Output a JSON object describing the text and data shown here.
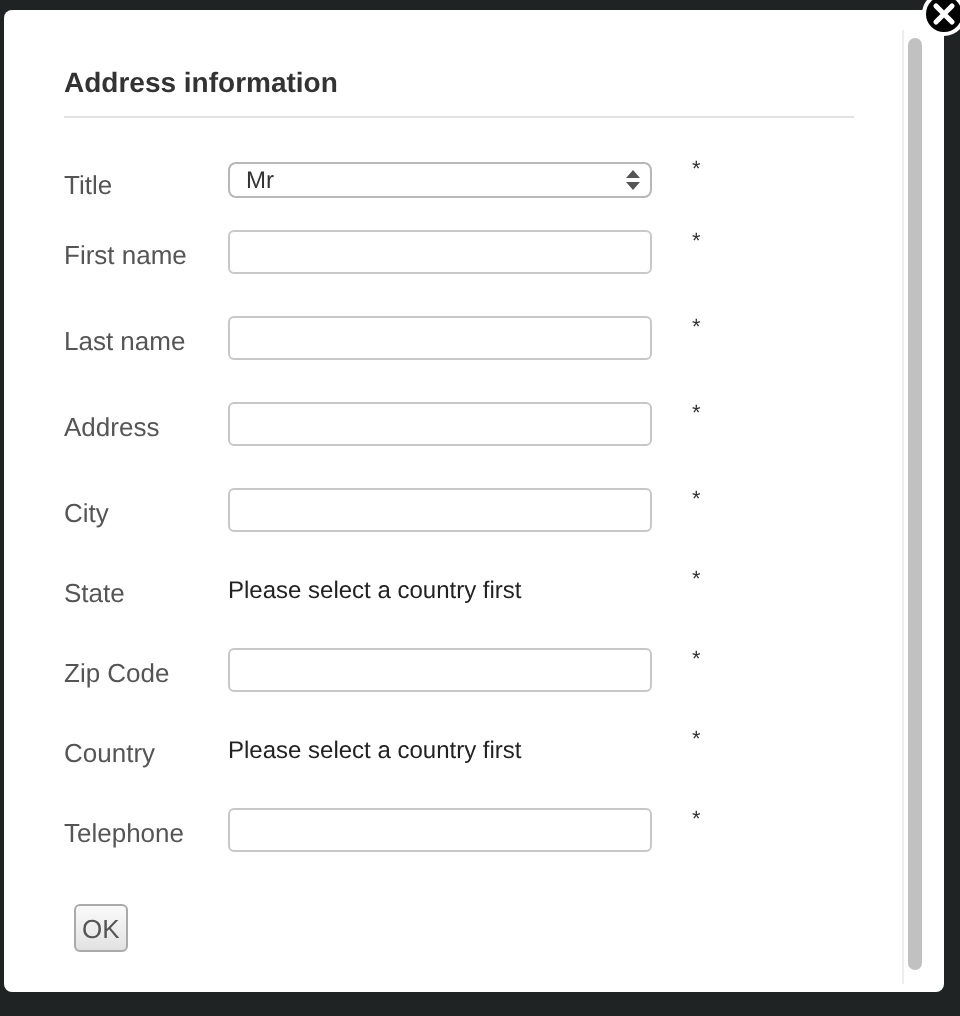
{
  "dialog": {
    "heading": "Address information",
    "fields": [
      {
        "kind": "select",
        "label": "Title",
        "value": "Mr",
        "required_mark": "*"
      },
      {
        "kind": "input",
        "label": "First name",
        "required_mark": "*"
      },
      {
        "kind": "input",
        "label": "Last name",
        "required_mark": "*"
      },
      {
        "kind": "input",
        "label": "Address",
        "required_mark": "*"
      },
      {
        "kind": "input",
        "label": "City",
        "required_mark": "*"
      },
      {
        "kind": "text",
        "label": "State",
        "value": "Please select a country first",
        "required_mark": "*"
      },
      {
        "kind": "input",
        "label": "Zip Code",
        "required_mark": "*"
      },
      {
        "kind": "text",
        "label": "Country",
        "value": "Please select a country first",
        "required_mark": "*"
      },
      {
        "kind": "input",
        "label": "Telephone",
        "required_mark": "*"
      }
    ],
    "buttons": [
      "OK"
    ]
  }
}
